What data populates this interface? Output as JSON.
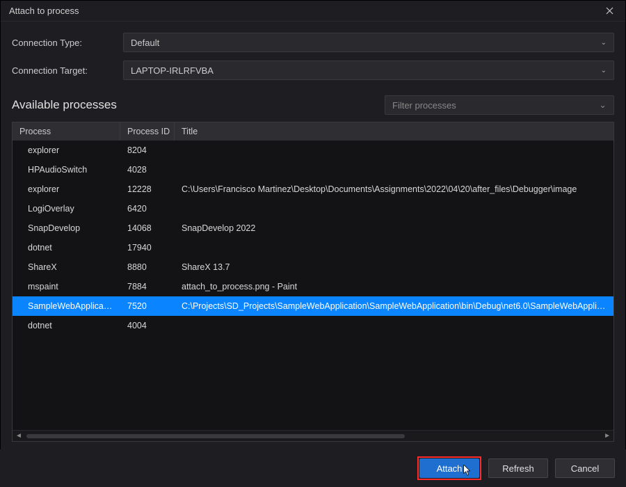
{
  "window": {
    "title": "Attach to process"
  },
  "form": {
    "connection_type_label": "Connection Type:",
    "connection_type_value": "Default",
    "connection_target_label": "Connection Target:",
    "connection_target_value": "LAPTOP-IRLRFVBA"
  },
  "section": {
    "title": "Available processes",
    "filter_placeholder": "Filter processes"
  },
  "table": {
    "columns": {
      "process": "Process",
      "pid": "Process ID",
      "title": "Title"
    },
    "rows": [
      {
        "process": "explorer",
        "pid": "8204",
        "title": "",
        "selected": false
      },
      {
        "process": "HPAudioSwitch",
        "pid": "4028",
        "title": "",
        "selected": false
      },
      {
        "process": "explorer",
        "pid": "12228",
        "title": "C:\\Users\\Francisco Martinez\\Desktop\\Documents\\Assignments\\2022\\04\\20\\after_files\\Debugger\\image",
        "selected": false
      },
      {
        "process": "LogiOverlay",
        "pid": "6420",
        "title": "",
        "selected": false
      },
      {
        "process": "SnapDevelop",
        "pid": "14068",
        "title": "SnapDevelop 2022",
        "selected": false
      },
      {
        "process": "dotnet",
        "pid": "17940",
        "title": "",
        "selected": false
      },
      {
        "process": "ShareX",
        "pid": "8880",
        "title": "ShareX 13.7",
        "selected": false
      },
      {
        "process": "mspaint",
        "pid": "7884",
        "title": "attach_to_process.png - Paint",
        "selected": false
      },
      {
        "process": "SampleWebApplication",
        "pid": "7520",
        "title": "C:\\Projects\\SD_Projects\\SampleWebApplication\\SampleWebApplication\\bin\\Debug\\net6.0\\SampleWebApplication.exe",
        "selected": true
      },
      {
        "process": "dotnet",
        "pid": "4004",
        "title": "",
        "selected": false
      }
    ]
  },
  "footer": {
    "attach": "Attach",
    "refresh": "Refresh",
    "cancel": "Cancel"
  }
}
